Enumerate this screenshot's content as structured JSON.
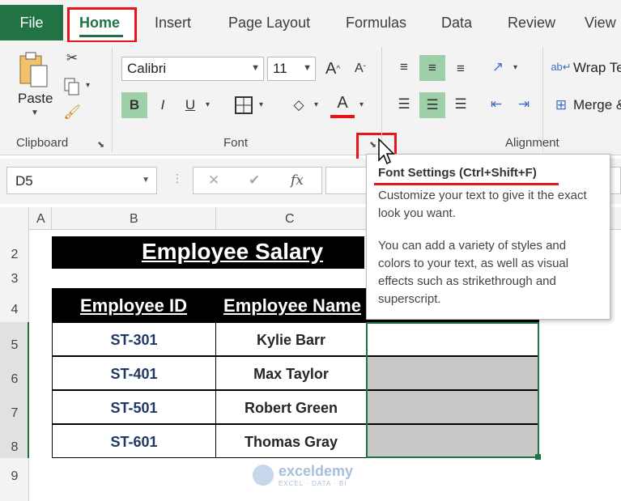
{
  "tabs": {
    "file": "File",
    "home": "Home",
    "insert": "Insert",
    "page_layout": "Page Layout",
    "formulas": "Formulas",
    "data": "Data",
    "review": "Review",
    "view": "View"
  },
  "ribbon": {
    "clipboard": {
      "paste_label": "Paste",
      "group_label": "Clipboard"
    },
    "font": {
      "font_name": "Calibri",
      "font_size": "11",
      "bold": "B",
      "italic": "I",
      "underline": "U",
      "group_label": "Font"
    },
    "alignment": {
      "wrap_text": "Wrap Te",
      "merge": "Merge &",
      "group_label": "Alignment"
    }
  },
  "formula_bar": {
    "name_box": "D5",
    "cancel": "✕",
    "enter": "✔",
    "fx": "fx"
  },
  "tooltip": {
    "title": "Font Settings (Ctrl+Shift+F)",
    "line1": "Customize your text to give it the exact look you want.",
    "line2": "You can add a variety of styles and colors to your text, as well as visual effects such as strikethrough and superscript."
  },
  "grid": {
    "columns": [
      "A",
      "B",
      "C"
    ],
    "rows": [
      "2",
      "3",
      "4",
      "5",
      "6",
      "7",
      "8",
      "9"
    ],
    "title": "Employee Salary",
    "headers": [
      "Employee ID",
      "Employee Name"
    ],
    "data": [
      {
        "id": "ST-301",
        "name": "Kylie Barr"
      },
      {
        "id": "ST-401",
        "name": "Max Taylor"
      },
      {
        "id": "ST-501",
        "name": "Robert Green"
      },
      {
        "id": "ST-601",
        "name": "Thomas Gray"
      }
    ]
  },
  "watermark": {
    "brand": "exceldemy",
    "tagline": "EXCEL · DATA · BI"
  },
  "colors": {
    "excel_green": "#217346",
    "highlight_red": "#e8141b",
    "active_button": "#9ecfa8",
    "shaded_cell": "#c8c8c8"
  }
}
